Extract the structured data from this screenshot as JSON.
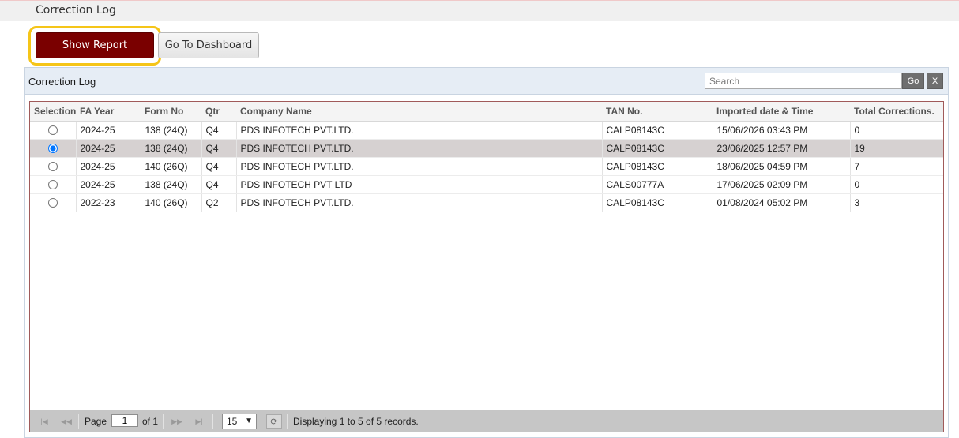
{
  "page": {
    "title": "Correction Log"
  },
  "toolbar": {
    "show_report_label": "Show Report",
    "dashboard_label": "Go To Dashboard"
  },
  "panel": {
    "title": "Correction Log",
    "search_placeholder": "Search",
    "go_label": "Go",
    "clear_label": "X"
  },
  "grid": {
    "columns": [
      "Selection",
      "FA Year",
      "Form No",
      "Qtr",
      "Company Name",
      "TAN No.",
      "Imported date & Time",
      "Total Corrections."
    ],
    "rows": [
      {
        "selected": false,
        "fa_year": "2024-25",
        "form_no": "138 (24Q)",
        "qtr": "Q4",
        "company": "PDS INFOTECH PVT.LTD.",
        "tan": "CALP08143C",
        "imported": "15/06/2026 03:43 PM",
        "corrections": "0"
      },
      {
        "selected": true,
        "fa_year": "2024-25",
        "form_no": "138 (24Q)",
        "qtr": "Q4",
        "company": "PDS INFOTECH PVT.LTD.",
        "tan": "CALP08143C",
        "imported": "23/06/2025 12:57 PM",
        "corrections": "19"
      },
      {
        "selected": false,
        "fa_year": "2024-25",
        "form_no": "140 (26Q)",
        "qtr": "Q4",
        "company": "PDS INFOTECH PVT.LTD.",
        "tan": "CALP08143C",
        "imported": "18/06/2025 04:59 PM",
        "corrections": "7"
      },
      {
        "selected": false,
        "fa_year": "2024-25",
        "form_no": "138 (24Q)",
        "qtr": "Q4",
        "company": "PDS INFOTECH PVT LTD",
        "tan": "CALS00777A",
        "imported": "17/06/2025 02:09 PM",
        "corrections": "0"
      },
      {
        "selected": false,
        "fa_year": "2022-23",
        "form_no": "140 (26Q)",
        "qtr": "Q2",
        "company": "PDS INFOTECH PVT.LTD.",
        "tan": "CALP08143C",
        "imported": "01/08/2024 05:02 PM",
        "corrections": "3"
      }
    ]
  },
  "pager": {
    "page_label": "Page",
    "page_value": "1",
    "of_label": "of 1",
    "page_size": "15",
    "status": "Displaying 1 to 5 of 5 records."
  },
  "colors": {
    "accent": "#7a0000",
    "highlight": "#f5c518",
    "selected_row": "#d6d1d1",
    "panel_header": "#e6edf5"
  }
}
